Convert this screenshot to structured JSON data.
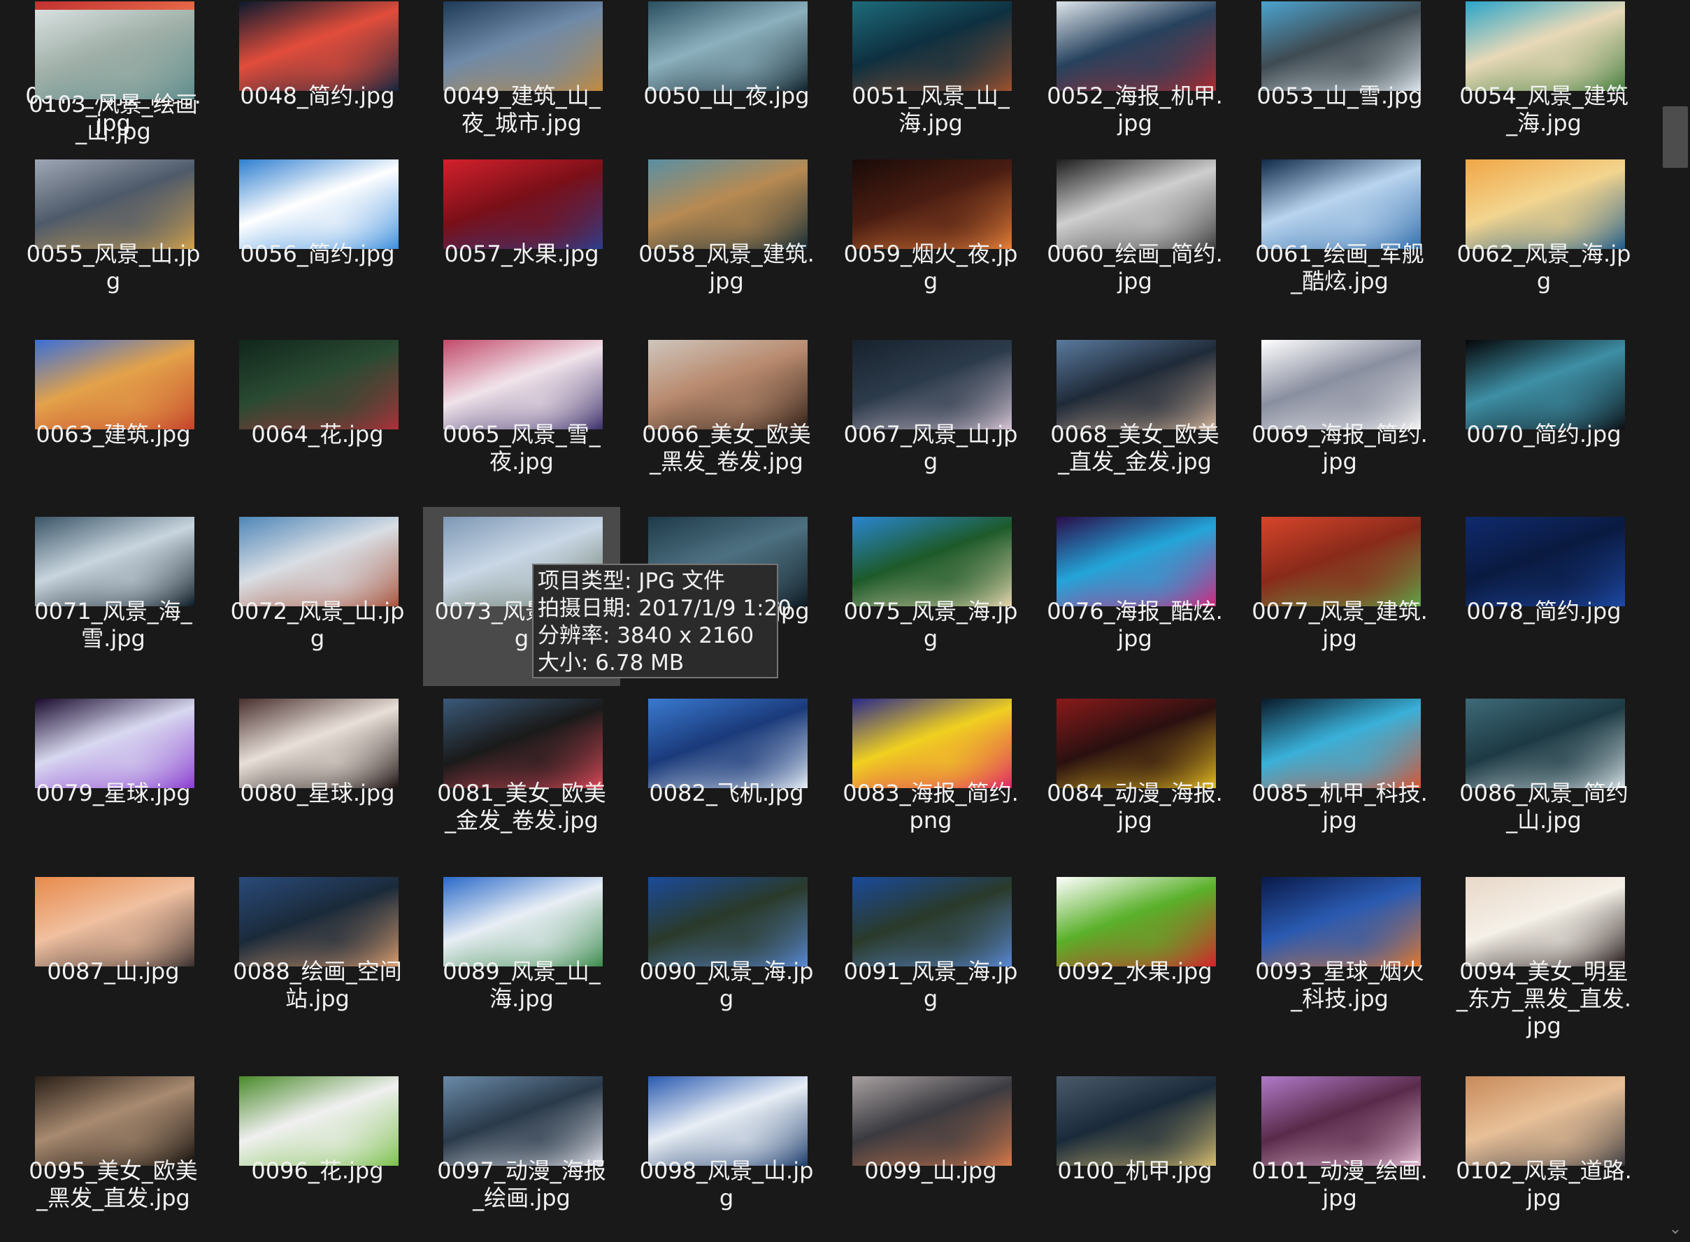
{
  "files": [
    {
      "name": "0047_海报_简约.jpg",
      "colors": [
        "#c03030",
        "#2a0b12",
        "#e86a4a"
      ]
    },
    {
      "name": "0048_简约.jpg",
      "colors": [
        "#0c1a2e",
        "#12263f",
        "#e24d3b"
      ]
    },
    {
      "name": "0049_建筑_山_夜_城市.jpg",
      "colors": [
        "#1d3a56",
        "#c48a3a",
        "#6f8aa8"
      ]
    },
    {
      "name": "0050_山_夜.jpg",
      "colors": [
        "#2a4f5f",
        "#10232c",
        "#8cb0bd"
      ]
    },
    {
      "name": "0051_风景_山_海.jpg",
      "colors": [
        "#1d6b7a",
        "#a0522d",
        "#0e3040"
      ]
    },
    {
      "name": "0052_海报_机甲.jpg",
      "colors": [
        "#dde4ea",
        "#b0292c",
        "#27425e"
      ]
    },
    {
      "name": "0053_山_雪.jpg",
      "colors": [
        "#4ba3cf",
        "#dfe8ee",
        "#3f4b52"
      ]
    },
    {
      "name": "0054_风景_建筑_海.jpg",
      "colors": [
        "#2aa4c8",
        "#3c7a3a",
        "#e8d9b8"
      ]
    },
    {
      "name": "0055_风景_山.jpg",
      "colors": [
        "#9fa7b5",
        "#d4a24a",
        "#4e5a6a"
      ]
    },
    {
      "name": "0056_简约.jpg",
      "colors": [
        "#2f7fd0",
        "#3b8ddd",
        "#ffffff"
      ]
    },
    {
      "name": "0057_水果.jpg",
      "colors": [
        "#d3212c",
        "#2b3f8f",
        "#7a0f18"
      ]
    },
    {
      "name": "0058_风景_建筑.jpg",
      "colors": [
        "#5a8fa3",
        "#0f2a36",
        "#b78a52"
      ]
    },
    {
      "name": "0059_烟火_夜.jpg",
      "colors": [
        "#1a0b08",
        "#e8813a",
        "#4a1d12"
      ]
    },
    {
      "name": "0060_绘画_简约.jpg",
      "colors": [
        "#1e1e1e",
        "#3b3b3b",
        "#cfcfcf"
      ]
    },
    {
      "name": "0061_绘画_军舰_酷炫.jpg",
      "colors": [
        "#0f2a4a",
        "#2d6aa8",
        "#b9d4ee"
      ]
    },
    {
      "name": "0062_风景_海.jpg",
      "colors": [
        "#f0a646",
        "#1b5a8c",
        "#f3d58f"
      ]
    },
    {
      "name": "0063_建筑.jpg",
      "colors": [
        "#3b6fd8",
        "#c4402a",
        "#e3a24a"
      ]
    },
    {
      "name": "0064_花.jpg",
      "colors": [
        "#10261c",
        "#b0303a",
        "#2a4a32"
      ]
    },
    {
      "name": "0065_风景_雪_夜.jpg",
      "colors": [
        "#c24a6a",
        "#3a2f6a",
        "#f0e3ea"
      ]
    },
    {
      "name": "0066_美女_欧美_黑发_卷发.jpg",
      "colors": [
        "#cfc5bc",
        "#2b1c14",
        "#b88a6e"
      ]
    },
    {
      "name": "0067_风景_山.jpg",
      "colors": [
        "#18222e",
        "#d8c6d6",
        "#2c3b4b"
      ]
    },
    {
      "name": "0068_美女_欧美_直发_金发.jpg",
      "colors": [
        "#5a7a9e",
        "#d5b49a",
        "#1f2a38"
      ]
    },
    {
      "name": "0069_海报_简约.jpg",
      "colors": [
        "#ffffff",
        "#f5f5f5",
        "#8a8fa0"
      ]
    },
    {
      "name": "0070_简约.jpg",
      "colors": [
        "#050608",
        "#0b0f14",
        "#3e8fa5"
      ]
    },
    {
      "name": "0071_风景_海_雪.jpg",
      "colors": [
        "#3b5568",
        "#0d1a24",
        "#c8d5de"
      ]
    },
    {
      "name": "0072_风景_山.jpg",
      "colors": [
        "#4e86b8",
        "#a9523a",
        "#d9dee4"
      ]
    },
    {
      "name": "0073_风景_山.jpg",
      "colors": [
        "#7e98b5",
        "#5c6b52",
        "#c9d7e6"
      ]
    },
    {
      "name": "0074_山_夜.jpg",
      "colors": [
        "#1e3a4a",
        "#0d1820",
        "#4d7080"
      ]
    },
    {
      "name": "0075_风景_海.jpg",
      "colors": [
        "#2a86d0",
        "#e8d8b0",
        "#1d5a2a"
      ]
    },
    {
      "name": "0076_海报_酷炫.jpg",
      "colors": [
        "#2a0d4a",
        "#d8237a",
        "#23a5d8"
      ]
    },
    {
      "name": "0077_风景_建筑.jpg",
      "colors": [
        "#d6452a",
        "#5fa84a",
        "#8a2a1a"
      ]
    },
    {
      "name": "0078_简约.jpg",
      "colors": [
        "#0f2a6e",
        "#1e4aa8",
        "#0a1a40"
      ]
    },
    {
      "name": "0079_星球.jpg",
      "colors": [
        "#1a0b2e",
        "#8a3ad0",
        "#d8d8f0"
      ]
    },
    {
      "name": "0080_星球.jpg",
      "colors": [
        "#4a3030",
        "#1a1010",
        "#e8e0d8"
      ]
    },
    {
      "name": "0081_美女_欧美_金发_卷发.jpg",
      "colors": [
        "#3a5a7a",
        "#e04a5a",
        "#1a1a1a"
      ]
    },
    {
      "name": "0082_飞机.jpg",
      "colors": [
        "#3a7ad0",
        "#e8f0f8",
        "#1a3a7a"
      ]
    },
    {
      "name": "0083_海报_简约.png",
      "colors": [
        "#2a2a8a",
        "#e0206a",
        "#f0d020"
      ]
    },
    {
      "name": "0084_动漫_海报.jpg",
      "colors": [
        "#8a1a1a",
        "#e8c020",
        "#2a1010"
      ]
    },
    {
      "name": "0085_机甲_科技.jpg",
      "colors": [
        "#0a1a2a",
        "#e0502a",
        "#3ab0d8"
      ]
    },
    {
      "name": "0086_风景_简约_山.jpg",
      "colors": [
        "#3e6a78",
        "#d8e4e8",
        "#1d3a44"
      ]
    },
    {
      "name": "0087_山.jpg",
      "colors": [
        "#e88a4a",
        "#3a3030",
        "#f0c0a0"
      ]
    },
    {
      "name": "0088_绘画_空间站.jpg",
      "colors": [
        "#2a4a7a",
        "#e0a070",
        "#1a2a3a"
      ]
    },
    {
      "name": "0089_风景_山_海.jpg",
      "colors": [
        "#2a6ac8",
        "#3a8a4a",
        "#e8eef5"
      ]
    },
    {
      "name": "0090_风景_海.jpg",
      "colors": [
        "#1a4a9a",
        "#5a8ad8",
        "#2a3a2a"
      ]
    },
    {
      "name": "0091_风景_海.jpg",
      "colors": [
        "#1a4a9a",
        "#5a8ad8",
        "#2a3a2a"
      ]
    },
    {
      "name": "0092_水果.jpg",
      "colors": [
        "#ffffff",
        "#d8202a",
        "#5ab02a"
      ]
    },
    {
      "name": "0093_星球_烟火_科技.jpg",
      "colors": [
        "#0a1a4a",
        "#e87a2a",
        "#2a5ab0"
      ]
    },
    {
      "name": "0094_美女_明星_东方_黑发_直发.jpg",
      "colors": [
        "#e8d8c8",
        "#1a1010",
        "#f5f0e8"
      ]
    },
    {
      "name": "0095_美女_欧美_黑发_直发.jpg",
      "colors": [
        "#2a2018",
        "#0d0a08",
        "#a88a70"
      ]
    },
    {
      "name": "0096_花.jpg",
      "colors": [
        "#4a8a2a",
        "#7ac04a",
        "#f0f0f0"
      ]
    },
    {
      "name": "0097_动漫_海报_绘画.jpg",
      "colors": [
        "#6a8aa8",
        "#e8e8f0",
        "#2a3a4a"
      ]
    },
    {
      "name": "0098_风景_山.jpg",
      "colors": [
        "#2a5ab0",
        "#1a3a6a",
        "#e8eef5"
      ]
    },
    {
      "name": "0099_山.jpg",
      "colors": [
        "#a8a0a0",
        "#d87a4a",
        "#3a3a40"
      ]
    },
    {
      "name": "0100_机甲.jpg",
      "colors": [
        "#4a5a6a",
        "#d8c070",
        "#1a2a3a"
      ]
    },
    {
      "name": "0101_动漫_绘画.jpg",
      "colors": [
        "#b07ac8",
        "#e8c0d8",
        "#5a2a4a"
      ]
    },
    {
      "name": "0102_风景_道路.jpg",
      "colors": [
        "#c88a5a",
        "#3a3a40",
        "#e8c098"
      ]
    },
    {
      "name": "0103_风景_绘画_山.jpg",
      "colors": [
        "#d8e0e0",
        "#5a8a8a",
        "#a0b0a8"
      ]
    }
  ],
  "hidden_under_tooltip": "0074",
  "tooltip": {
    "type_line": "项目类型: JPG 文件",
    "date_line": "拍摄日期: 2017/1/9 1:20",
    "resolution_line": "分辨率: 3840 x 2160",
    "size_line": "大小: 6.78 MB"
  },
  "label_overrides": {
    "0073": "0073_l",
    "0074": "pg"
  },
  "scrollbar": {
    "down_arrow": "⌄"
  },
  "theme": {
    "background": "#191919",
    "text": "#f2f2f2",
    "hover": "#4a4a4a",
    "tooltip_bg": "#2b2b2b",
    "tooltip_border": "#767676"
  }
}
